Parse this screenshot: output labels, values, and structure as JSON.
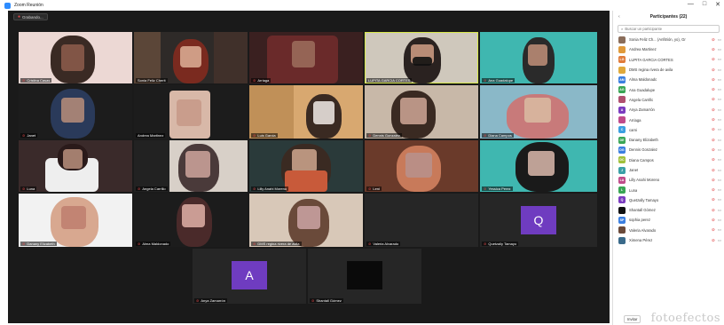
{
  "window": {
    "title": "Zoom Reunión",
    "controls": [
      "—",
      "□",
      "✕"
    ]
  },
  "meeting": {
    "status": "Grabando..."
  },
  "tiles": [
    {
      "name": "Cristina Casas",
      "muted": true
    },
    {
      "name": "Sonia Feliz Cherit",
      "muted": false
    },
    {
      "name": "Arriaga",
      "muted": true
    },
    {
      "name": "LUPITA GARCIA CORTES",
      "muted": false,
      "speaking": true
    },
    {
      "name": "Ana Guadalupe",
      "muted": true
    },
    {
      "name": "Janet",
      "muted": true
    },
    {
      "name": "Andrea Martinez",
      "muted": false
    },
    {
      "name": "Luis Garcia",
      "muted": true
    },
    {
      "name": "Dennis Gonzalez",
      "muted": true
    },
    {
      "name": "Diana Campos",
      "muted": true
    },
    {
      "name": "Luna",
      "muted": true
    },
    {
      "name": "Angela Carrillo",
      "muted": true
    },
    {
      "name": "Lilly Anahi Moreno",
      "muted": true
    },
    {
      "name": "Leni",
      "muted": true
    },
    {
      "name": "Yessica Perez",
      "muted": true
    },
    {
      "name": "Danany Elizabeth",
      "muted": true
    },
    {
      "name": "Alma Maldonado",
      "muted": true
    },
    {
      "name": "DMS regina rivera de avila",
      "muted": true
    },
    {
      "name": "Valeria Alvarado",
      "muted": true
    },
    {
      "name": "Quetzally Tamayo",
      "muted": true,
      "avatar_letter": "Q",
      "avatar_color": "#6f3cc0"
    },
    {
      "name": "Anya Zamarrón",
      "muted": true,
      "avatar_letter": "A",
      "avatar_color": "#6f3cc0"
    },
    {
      "name": "Shantall Gómez",
      "muted": true
    }
  ],
  "panel": {
    "back_icon": "‹",
    "title": "Participantes (22)",
    "search_placeholder": "Buscar un participante",
    "invite_label": "Invitar",
    "participants": [
      {
        "initials": "",
        "name": "Sonia Feliz Ch... (Anfitrión, yo), Gr",
        "color": "#8a6d5a"
      },
      {
        "initials": "",
        "name": "Andrea Martinez",
        "color": "#e09a3b"
      },
      {
        "initials": "LG",
        "name": "LUPITA GARCIA CORTES",
        "color": "#e07b39"
      },
      {
        "initials": "",
        "name": "DMS regina rivera de avila",
        "color": "#e0a93b"
      },
      {
        "initials": "AM",
        "name": "Alma Maldonado",
        "color": "#3b7fe0"
      },
      {
        "initials": "AG",
        "name": "Ana Guadalupe",
        "color": "#3aa655"
      },
      {
        "initials": "",
        "name": "Angela Carrillo",
        "color": "#b05070"
      },
      {
        "initials": "A",
        "name": "Anya Zamarrón",
        "color": "#7b3cc0"
      },
      {
        "initials": "",
        "name": "Arriaga",
        "color": "#c04b8a"
      },
      {
        "initials": "C",
        "name": "carni",
        "color": "#3b9fe0"
      },
      {
        "initials": "DE",
        "name": "Danany Elizabeth",
        "color": "#3aa655"
      },
      {
        "initials": "DG",
        "name": "Dennis Gonzalez",
        "color": "#3b7fe0"
      },
      {
        "initials": "DC",
        "name": "Diana Campos",
        "color": "#a0c03b"
      },
      {
        "initials": "J",
        "name": "Janet",
        "color": "#3aa0a6"
      },
      {
        "initials": "LA",
        "name": "Lilly Anahi Moreno",
        "color": "#c04b8a"
      },
      {
        "initials": "L",
        "name": "Luna",
        "color": "#3aa655"
      },
      {
        "initials": "Q",
        "name": "Quetzally Tamayo",
        "color": "#7b3cc0"
      },
      {
        "initials": "",
        "name": "Shantall Gómez",
        "color": "#111111"
      },
      {
        "initials": "SP",
        "name": "sophia perez",
        "color": "#3b7fe0"
      },
      {
        "initials": "",
        "name": "Valeria Alvarado",
        "color": "#6a4a3a"
      },
      {
        "initials": "",
        "name": "Ximena Pérez",
        "color": "#3a6a8a"
      }
    ]
  },
  "watermark": "fotoefectos"
}
